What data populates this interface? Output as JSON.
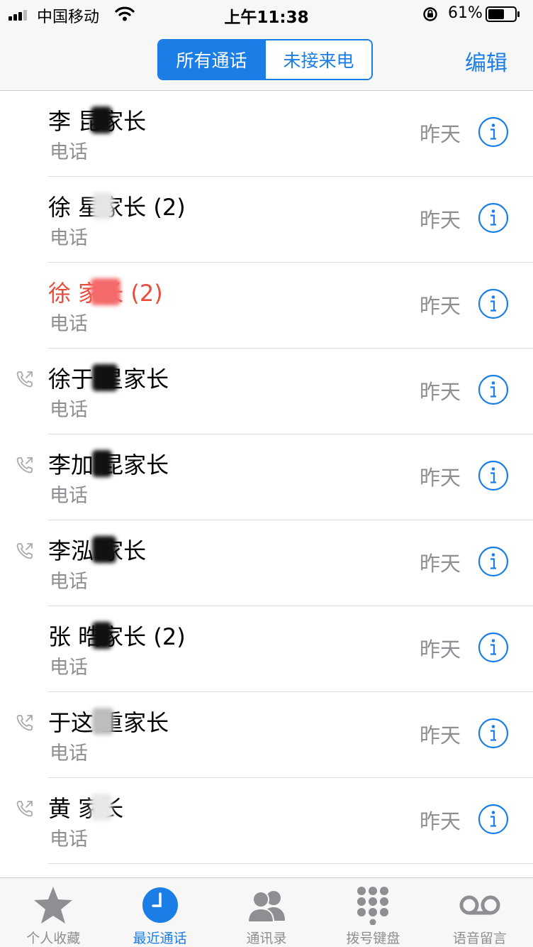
{
  "status_bar": {
    "carrier": "中国移动",
    "time": "上午11:38",
    "battery_percent": "61%",
    "battery_level": 0.61
  },
  "nav": {
    "segments": [
      "所有通话",
      "未接来电"
    ],
    "active_segment": 0,
    "edit_label": "编辑"
  },
  "calls": [
    {
      "name": "李   昆家长",
      "type": "电话",
      "when": "昨天",
      "missed": false,
      "outgoing": false
    },
    {
      "name": "徐    星家长 (2)",
      "type": "电话",
      "when": "昨天",
      "missed": false,
      "outgoing": false
    },
    {
      "name": "徐     家长 (2)",
      "type": "电话",
      "when": "昨天",
      "missed": true,
      "outgoing": false
    },
    {
      "name": "徐于   星家长",
      "type": "电话",
      "when": "昨天",
      "missed": false,
      "outgoing": true
    },
    {
      "name": "李加   昆家长",
      "type": "电话",
      "when": "昨天",
      "missed": false,
      "outgoing": true
    },
    {
      "name": "李泓     家长",
      "type": "电话",
      "when": "昨天",
      "missed": false,
      "outgoing": true
    },
    {
      "name": "张    晧家长 (2)",
      "type": "电话",
      "when": "昨天",
      "missed": false,
      "outgoing": false
    },
    {
      "name": "于这    重家长",
      "type": "电话",
      "when": "昨天",
      "missed": false,
      "outgoing": true
    },
    {
      "name": "黄     家长",
      "type": "电话",
      "when": "昨天",
      "missed": false,
      "outgoing": true
    }
  ],
  "tabs": [
    {
      "label": "个人收藏",
      "icon": "star-icon",
      "active": false
    },
    {
      "label": "最近通话",
      "icon": "clock-icon",
      "active": true
    },
    {
      "label": "通讯录",
      "icon": "contacts-icon",
      "active": false
    },
    {
      "label": "拨号键盘",
      "icon": "keypad-icon",
      "active": false
    },
    {
      "label": "语音留言",
      "icon": "voicemail-icon",
      "active": false
    }
  ],
  "colors": {
    "accent": "#1a7ee6",
    "missed": "#e74c3c",
    "secondary_text": "#8e8e93"
  }
}
